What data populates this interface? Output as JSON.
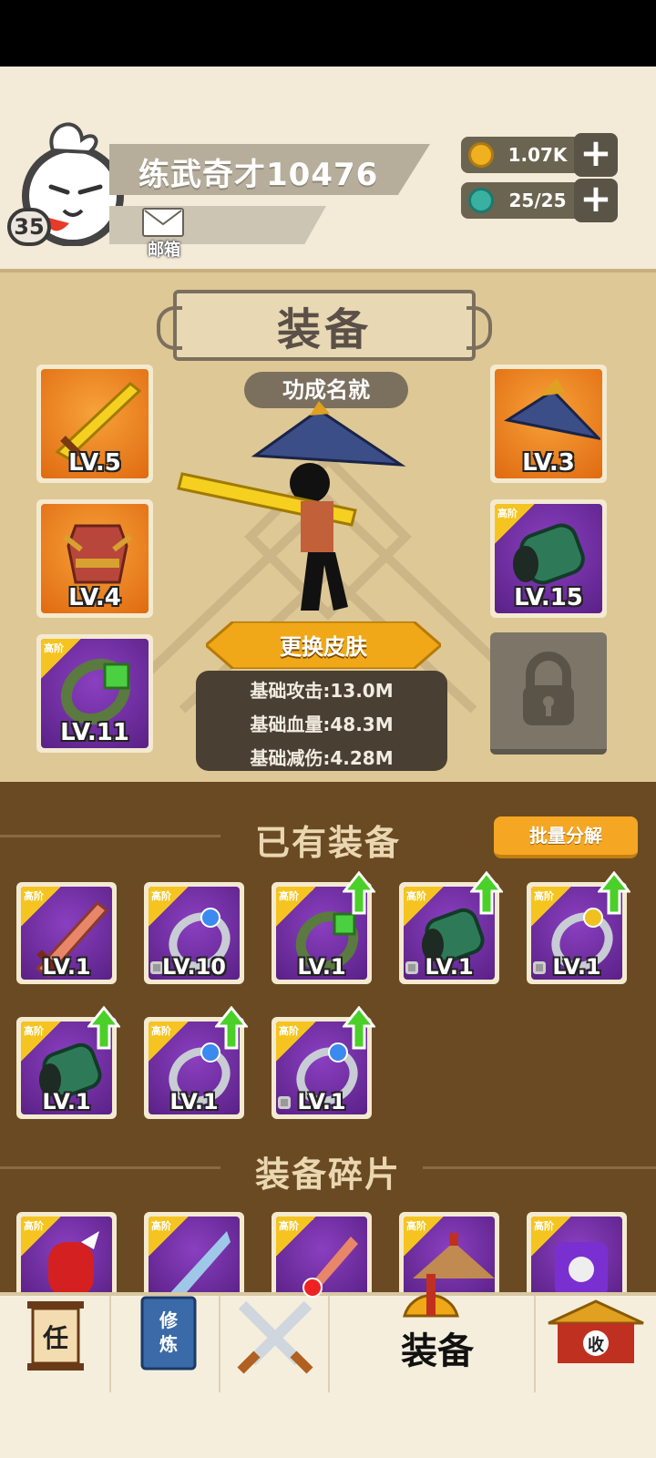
{
  "player": {
    "name": "练武奇才10476",
    "level": "35"
  },
  "mail": {
    "label": "邮箱"
  },
  "resources": {
    "coins": "1.07K",
    "energy": "25/25"
  },
  "equip_panel": {
    "title": "装备",
    "achievement": "功成名就",
    "slots": [
      {
        "type": "sword",
        "level": "LV.5",
        "rarity": "orange"
      },
      {
        "type": "armor",
        "level": "LV.4",
        "rarity": "orange"
      },
      {
        "type": "ring",
        "level": "LV.11",
        "rarity": "purple",
        "tag": "高阶"
      },
      {
        "type": "hat",
        "level": "LV.3",
        "rarity": "orange"
      },
      {
        "type": "bracer",
        "level": "LV.15",
        "rarity": "purple",
        "tag": "高阶"
      }
    ],
    "change_skin": "更换皮肤",
    "stats": {
      "attack": "基础攻击:13.0M",
      "hp": "基础血量:48.3M",
      "defense": "基础减伤:4.28M"
    }
  },
  "owned": {
    "title": "已有装备",
    "batch_button": "批量分解",
    "tag": "高阶",
    "items": [
      {
        "type": "sword",
        "level": "LV.1",
        "upgrade": false,
        "locked": false
      },
      {
        "type": "ring-blue",
        "level": "LV.10",
        "upgrade": false,
        "locked": true
      },
      {
        "type": "ring-green",
        "level": "LV.1",
        "upgrade": true,
        "locked": false
      },
      {
        "type": "bracer",
        "level": "LV.1",
        "upgrade": true,
        "locked": true
      },
      {
        "type": "ring-gold",
        "level": "LV.1",
        "upgrade": true,
        "locked": true
      },
      {
        "type": "bracer",
        "level": "LV.1",
        "upgrade": true,
        "locked": false
      },
      {
        "type": "ring-blue",
        "level": "LV.1",
        "upgrade": true,
        "locked": false
      },
      {
        "type": "ring-blue",
        "level": "LV.1",
        "upgrade": true,
        "locked": true
      }
    ]
  },
  "fragments": {
    "title": "装备碎片"
  },
  "nav": {
    "task": "任",
    "cultivate": "修炼",
    "equip": "装备",
    "collect": "收"
  }
}
